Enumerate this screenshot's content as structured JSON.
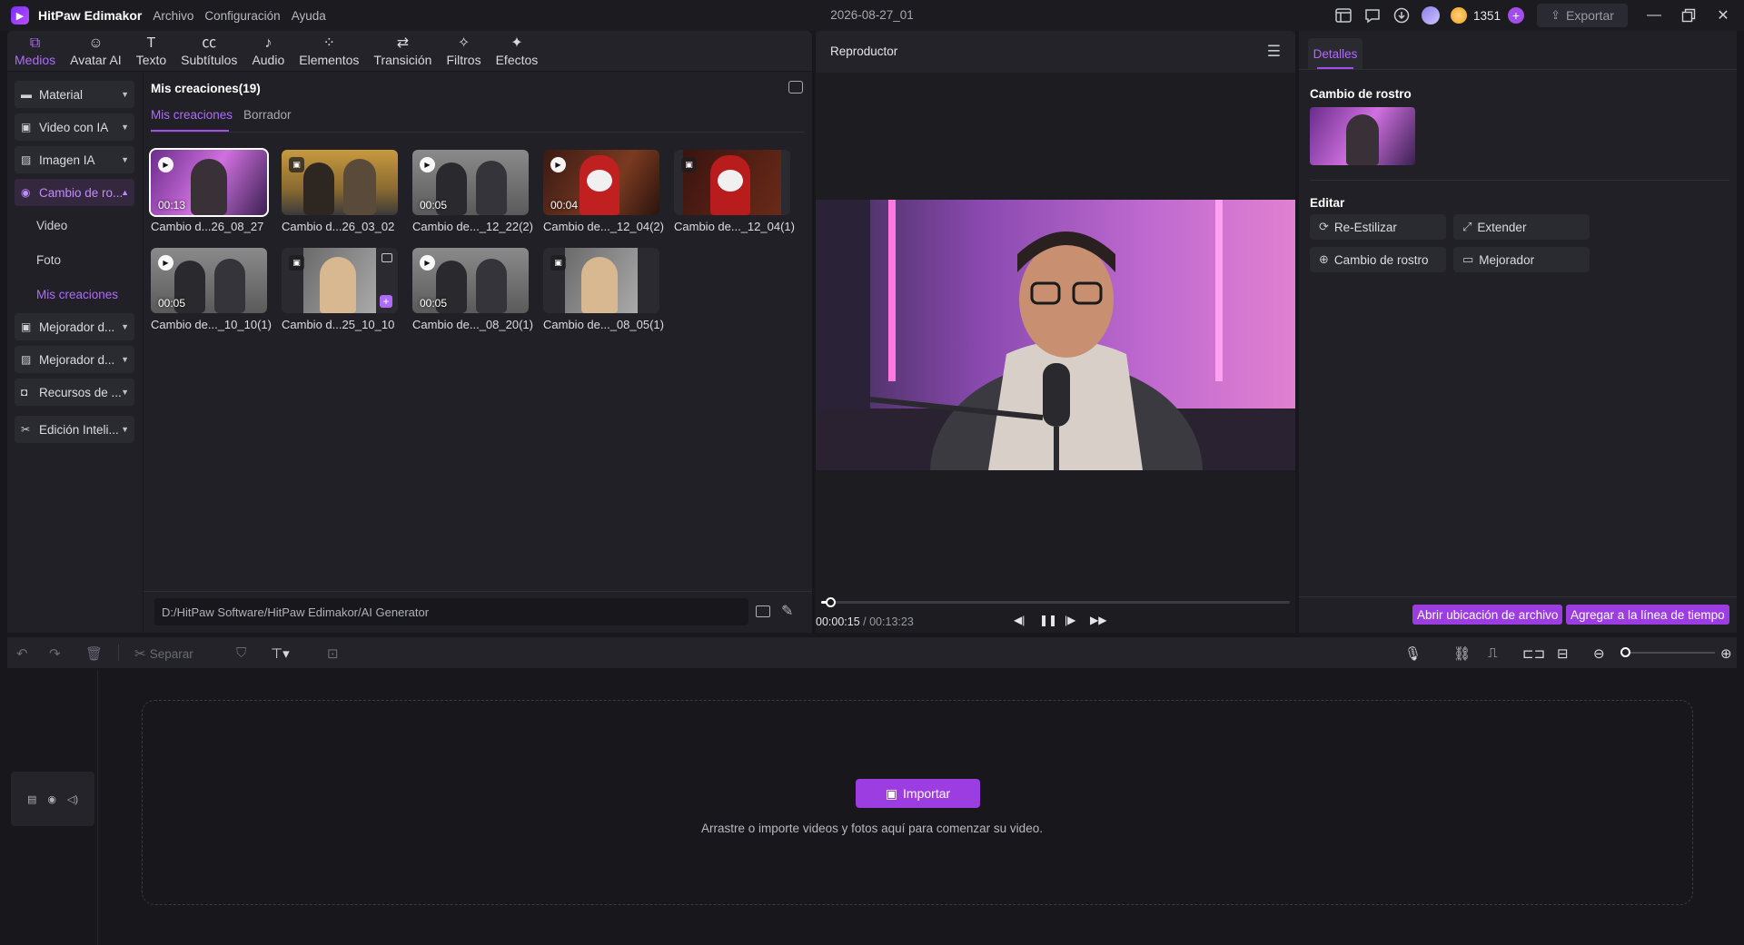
{
  "titlebar": {
    "app_name": "HitPaw Edimakor",
    "menu": [
      "Archivo",
      "Configuración",
      "Ayuda"
    ],
    "project": "2026-08-27_01",
    "credits": "1351",
    "export_label": "Exportar"
  },
  "toolbar": {
    "tools": [
      {
        "label": "Medios",
        "icon": "media-icon"
      },
      {
        "label": "Avatar AI",
        "icon": "avatar-icon"
      },
      {
        "label": "Texto",
        "icon": "text-icon"
      },
      {
        "label": "Subtítulos",
        "icon": "subtitles-icon"
      },
      {
        "label": "Audio",
        "icon": "audio-icon"
      },
      {
        "label": "Elementos",
        "icon": "elements-icon"
      },
      {
        "label": "Transición",
        "icon": "transition-icon"
      },
      {
        "label": "Filtros",
        "icon": "filters-icon"
      },
      {
        "label": "Efectos",
        "icon": "effects-icon"
      }
    ]
  },
  "sidebar": {
    "items": [
      {
        "label": "Material"
      },
      {
        "label": "Video con IA"
      },
      {
        "label": "Imagen IA"
      },
      {
        "label": "Cambio de ro..."
      },
      {
        "label": "Mejorador d..."
      },
      {
        "label": "Mejorador d..."
      },
      {
        "label": "Recursos de ..."
      },
      {
        "label": "Edición Inteli..."
      }
    ],
    "subitems": [
      "Video",
      "Foto",
      "Mis creaciones"
    ]
  },
  "media": {
    "title": "Mis creaciones(19)",
    "tabs": [
      "Mis creaciones",
      "Borrador"
    ],
    "items": [
      {
        "caption": "Cambio d...26_08_27",
        "duration": "00:13",
        "kind": "video"
      },
      {
        "caption": "Cambio d...26_03_02",
        "duration": "",
        "kind": "image"
      },
      {
        "caption": "Cambio de..._12_22(2)",
        "duration": "00:05",
        "kind": "video"
      },
      {
        "caption": "Cambio de..._12_04(2)",
        "duration": "00:04",
        "kind": "video"
      },
      {
        "caption": "Cambio de..._12_04(1)",
        "duration": "",
        "kind": "image"
      },
      {
        "caption": "Cambio de..._10_10(1)",
        "duration": "00:05",
        "kind": "video"
      },
      {
        "caption": "Cambio d...25_10_10",
        "duration": "",
        "kind": "image"
      },
      {
        "caption": "Cambio de..._08_20(1)",
        "duration": "00:05",
        "kind": "video"
      },
      {
        "caption": "Cambio de..._08_05(1)",
        "duration": "",
        "kind": "image"
      }
    ],
    "path": "D:/HitPaw Software/HitPaw Edimakor/AI Generator"
  },
  "player": {
    "title": "Reproductor",
    "current_time": "00:00:15",
    "total_time": "00:13:23",
    "progress": 0.02
  },
  "details": {
    "tab": "Detalles",
    "section_face": "Cambio de rostro",
    "section_edit": "Editar",
    "actions": [
      {
        "label": "Re-Estilizar",
        "icon": "restyle-icon"
      },
      {
        "label": "Extender",
        "icon": "extend-icon"
      },
      {
        "label": "Cambio de rostro",
        "icon": "face-swap-icon"
      },
      {
        "label": "Mejorador",
        "icon": "hd-icon"
      }
    ],
    "open_location": "Abrir ubicación de archivo",
    "add_to_timeline": "Agregar a la línea de tiempo"
  },
  "timeline": {
    "split_label": "Separar",
    "import_label": "Importar",
    "drop_hint": "Arrastre o importe videos y fotos aquí para comenzar su video."
  },
  "colors": {
    "accent": "#a24ee8",
    "background": "#18181c",
    "panel": "#202026"
  }
}
